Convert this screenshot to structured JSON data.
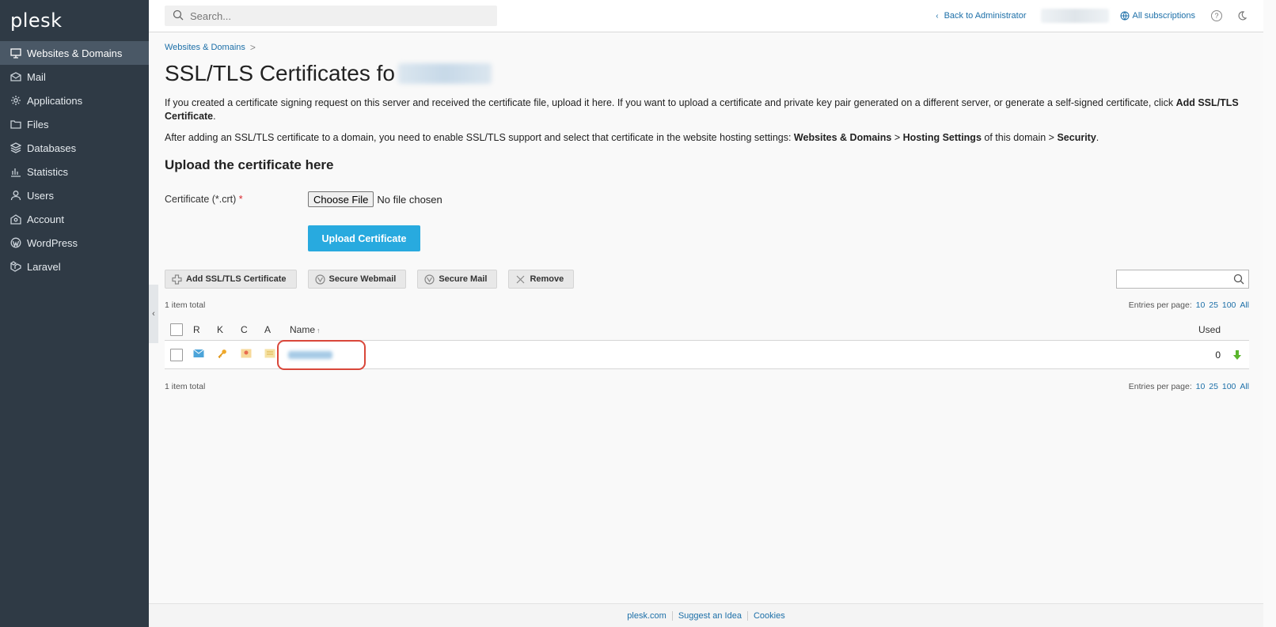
{
  "brand": {
    "logo_text": "plesk"
  },
  "sidebar": {
    "items": [
      {
        "label": "Websites & Domains",
        "icon": "monitor-icon",
        "active": true
      },
      {
        "label": "Mail",
        "icon": "mail-icon"
      },
      {
        "label": "Applications",
        "icon": "gear-icon"
      },
      {
        "label": "Files",
        "icon": "folder-icon"
      },
      {
        "label": "Databases",
        "icon": "database-icon"
      },
      {
        "label": "Statistics",
        "icon": "bar-chart-icon"
      },
      {
        "label": "Users",
        "icon": "user-icon"
      },
      {
        "label": "Account",
        "icon": "account-icon"
      },
      {
        "label": "WordPress",
        "icon": "wordpress-icon"
      },
      {
        "label": "Laravel",
        "icon": "laravel-icon"
      }
    ],
    "collapse_glyph": "‹"
  },
  "topbar": {
    "search_placeholder": "Search...",
    "back_link": "Back to Administrator",
    "subscriptions_link": "All subscriptions",
    "help_glyph": "?"
  },
  "main": {
    "breadcrumb": "Websites & Domains",
    "breadcrumb_sep": ">",
    "title_prefix": "SSL/TLS Certificates fo",
    "desc1": {
      "text": "If you created a certificate signing request on this server and received the certificate file, upload it here. If you want to upload a certificate and private key pair generated on a different server, or generate a self-signed certificate, click ",
      "bold": "Add SSL/TLS Certificate",
      "end": "."
    },
    "desc2": {
      "p1": "After adding an SSL/TLS certificate to a domain, you need to enable SSL/TLS support and select that certificate in the website hosting settings: ",
      "b1": "Websites & Domains",
      "p2": " > ",
      "b2": "Hosting Settings",
      "p3": " of this domain > ",
      "b3": "Security",
      "p4": "."
    },
    "upload_section_title": "Upload the certificate here",
    "certificate_label": "Certificate (*.crt)",
    "required_mark": "*",
    "choose_file": "Choose File",
    "no_file": "No file chosen",
    "upload_button": "Upload Certificate"
  },
  "toolbar": {
    "add_cert": "Add SSL/TLS Certificate",
    "secure_webmail": "Secure Webmail",
    "secure_mail": "Secure Mail",
    "remove": "Remove"
  },
  "list": {
    "total_top": "1 item total",
    "total_bottom": "1 item total",
    "entries_label": "Entries per page:",
    "entries_options": [
      "10",
      "25",
      "100",
      "All"
    ],
    "columns": {
      "r": "R",
      "k": "K",
      "c": "C",
      "a": "A",
      "name": "Name",
      "sort_glyph": "↑",
      "used": "Used"
    },
    "rows": [
      {
        "used": "0"
      }
    ]
  },
  "footer": {
    "links": [
      "plesk.com",
      "Suggest an Idea",
      "Cookies"
    ]
  },
  "colors": {
    "sidebar_bg": "#2f3a45",
    "accent": "#28aadf",
    "link": "#1c6fa8",
    "highlight": "#d9473a"
  }
}
